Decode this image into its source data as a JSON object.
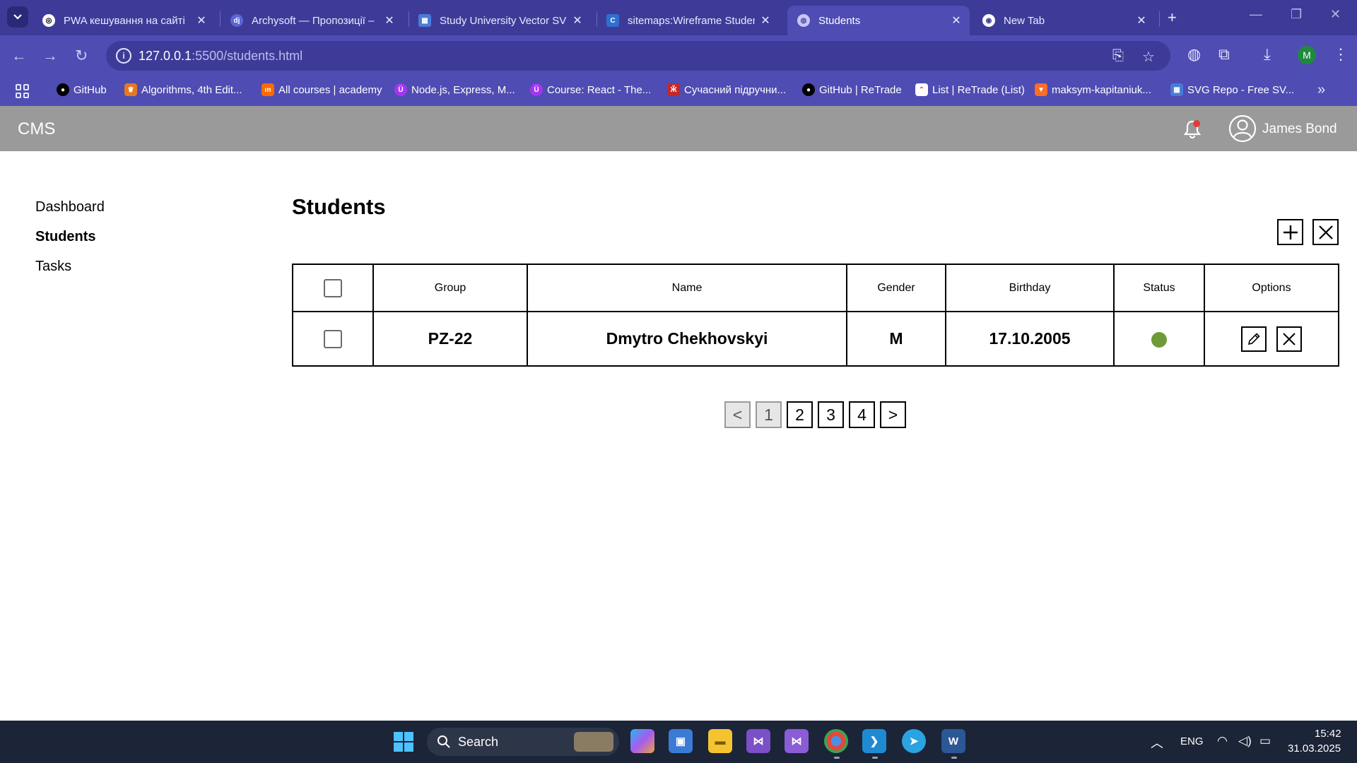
{
  "browser": {
    "tabs": [
      {
        "title": "PWA кешування на сайті",
        "favicon": "openai-icon",
        "active": false
      },
      {
        "title": "Archysoft — Пропозиції –",
        "favicon": "dj-icon",
        "active": false
      },
      {
        "title": "Study University Vector SV",
        "favicon": "svgrepo-icon",
        "active": false
      },
      {
        "title": "sitemaps:Wireframe Studen",
        "favicon": "c-icon",
        "active": false
      },
      {
        "title": "Students",
        "favicon": "globe-icon",
        "active": true
      },
      {
        "title": "New Tab",
        "favicon": "chrome-icon",
        "active": false
      }
    ],
    "url_host": "127.0.0.1",
    "url_path": ":5500/students.html",
    "profile_initial": "M",
    "bookmarks": [
      {
        "label": "GitHub",
        "icon": "github-icon",
        "color": "#000000"
      },
      {
        "label": "Algorithms, 4th Edit...",
        "icon": "princeton-icon",
        "color": "#e87722"
      },
      {
        "label": "All courses | academy",
        "icon": "academy-icon",
        "color": "#ff6a00"
      },
      {
        "label": "Node.js, Express, M...",
        "icon": "udemy-icon",
        "color": "#a435f0"
      },
      {
        "label": "Course: React - The...",
        "icon": "udemy-icon",
        "color": "#a435f0"
      },
      {
        "label": "Сучасний підручни...",
        "icon": "book-icon",
        "color": "#c62828"
      },
      {
        "label": "GitHub | ReTrade",
        "icon": "github-icon",
        "color": "#000000"
      },
      {
        "label": "List | ReTrade (List)",
        "icon": "clickup-icon",
        "color": "#ffffff"
      },
      {
        "label": "maksym-kapitaniuk...",
        "icon": "gitlab-icon",
        "color": "#fc6d26"
      },
      {
        "label": "SVG Repo - Free SV...",
        "icon": "svgrepo-icon",
        "color": "#4a7bd8"
      }
    ]
  },
  "app": {
    "brand": "CMS",
    "user_name": "James Bond",
    "nav": [
      {
        "label": "Dashboard",
        "active": false
      },
      {
        "label": "Students",
        "active": true
      },
      {
        "label": "Tasks",
        "active": false
      }
    ],
    "page_title": "Students",
    "table": {
      "headers": [
        "Group",
        "Name",
        "Gender",
        "Birthday",
        "Status",
        "Options"
      ],
      "rows": [
        {
          "group": "PZ-22",
          "name": "Dmytro Chekhovskyi",
          "gender": "M",
          "birthday": "17.10.2005",
          "status": "active"
        }
      ]
    },
    "pagination": [
      "<",
      "1",
      "2",
      "3",
      "4",
      ">"
    ],
    "status_color": "#6e9a37",
    "header_color": "#9a9a9a"
  },
  "taskbar": {
    "search_label": "Search",
    "language": "ENG",
    "time": "15:42",
    "date": "31.03.2025"
  }
}
